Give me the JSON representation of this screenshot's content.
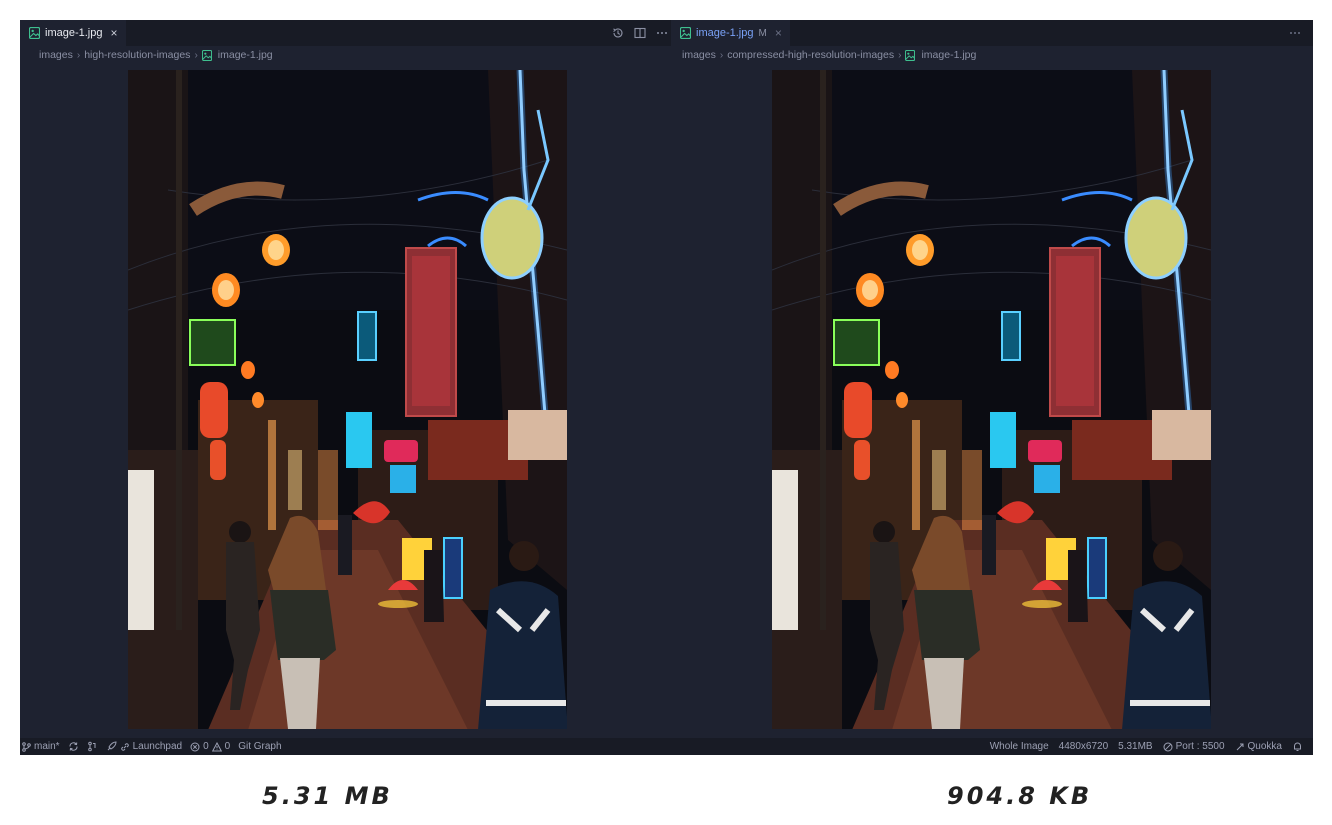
{
  "left_editor": {
    "tab": {
      "filename": "image-1.jpg",
      "close_glyph": "×"
    },
    "actions": [
      "history-icon",
      "split-editor-icon",
      "more-actions-icon"
    ],
    "breadcrumb": {
      "root": "images",
      "folder": "high-resolution-images",
      "file": "image-1.jpg"
    },
    "image_caption": "5.31 MB"
  },
  "right_editor": {
    "tab": {
      "filename": "image-1.jpg",
      "modified_badge": "M",
      "close_glyph": "×"
    },
    "actions": [
      "more-actions-icon"
    ],
    "breadcrumb": {
      "root": "images",
      "folder": "compressed-high-resolution-images",
      "file": "image-1.jpg"
    },
    "image_caption": "904.8 KB"
  },
  "statusbar": {
    "branch": "main*",
    "launchpad": "Launchpad",
    "errors": "0",
    "warnings": "0",
    "git_graph": "Git Graph",
    "zoom": "Whole Image",
    "dimensions": "4480x6720",
    "filesize": "5.31MB",
    "port": "Port : 5500",
    "quokka": "Quokka"
  },
  "colors": {
    "editor_bg": "#1e2230",
    "tabbar_bg": "#181b25",
    "accent_tab_text": "#7aa2f7",
    "file_icon": "#3fbf8f"
  }
}
